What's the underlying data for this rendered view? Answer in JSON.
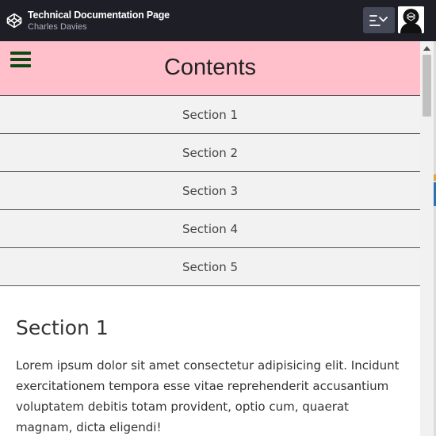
{
  "header": {
    "title": "Technical Documentation Page",
    "author": "Charles Davies"
  },
  "icons": {
    "logo": "codepen-logo-icon",
    "layout": "layout-toggle-icon",
    "avatar": "user-avatar-icon",
    "menu": "hamburger-menu-icon",
    "scroll_up": "scroll-up-arrow-icon"
  },
  "nav": {
    "title": "Contents",
    "items": [
      {
        "label": "Section 1"
      },
      {
        "label": "Section 2"
      },
      {
        "label": "Section 3"
      },
      {
        "label": "Section 4"
      },
      {
        "label": "Section 5"
      }
    ]
  },
  "main": {
    "sections": [
      {
        "heading": "Section 1",
        "text": "Lorem ipsum dolor sit amet consectetur adipisicing elit. Incidunt exercitationem tempora esse vitae reprehenderit accusantium voluptatem debitis totam provident, optio cum, quaerat magnam, dicta eligendi!"
      }
    ]
  },
  "colors": {
    "topbar": "#1e1f26",
    "nav_header_bg": "#ffc0cb",
    "nav_item_bg": "#f2f2f2",
    "hamburger": "#0a4a12",
    "layout_button": "#444857"
  }
}
